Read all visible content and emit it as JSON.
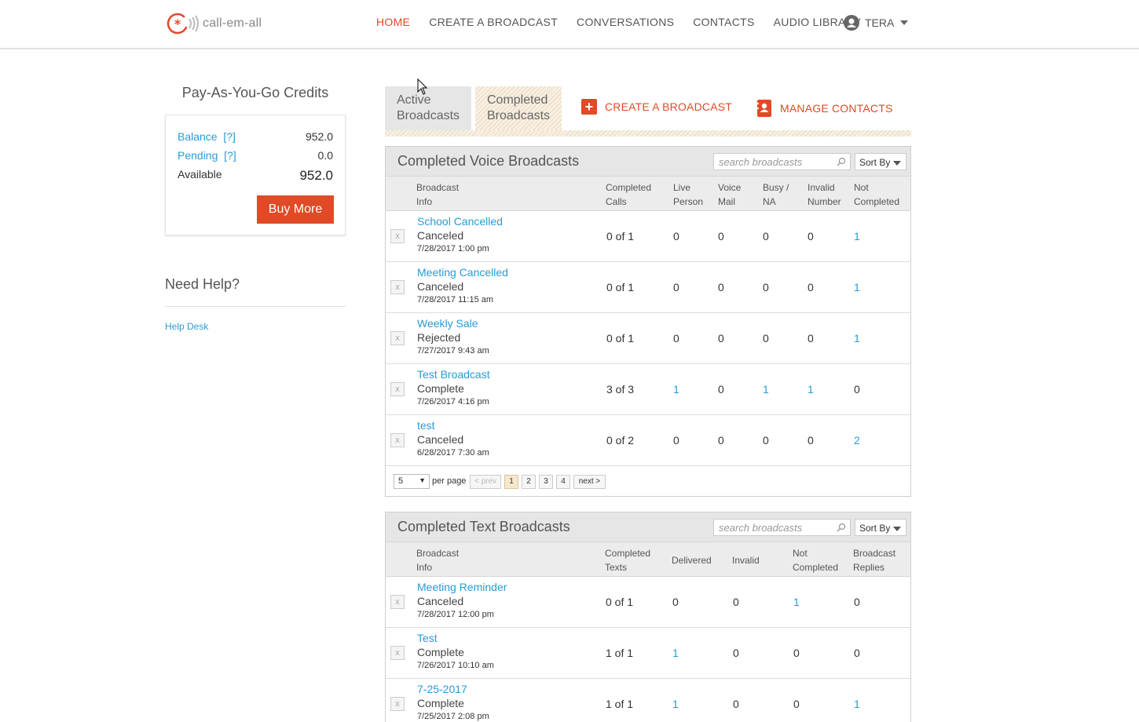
{
  "brand": {
    "name": "call-em-all"
  },
  "nav": {
    "items": [
      {
        "label": "HOME",
        "active": true
      },
      {
        "label": "CREATE A BROADCAST"
      },
      {
        "label": "CONVERSATIONS"
      },
      {
        "label": "CONTACTS"
      },
      {
        "label": "AUDIO LIBRARY"
      }
    ],
    "user": "TERA"
  },
  "credits": {
    "title": "Pay-As-You-Go Credits",
    "balance_label": "Balance  [?]",
    "balance": "952.0",
    "pending_label": "Pending  [?]",
    "pending": "0.0",
    "available_label": "Available",
    "available": "952.0",
    "buy_label": "Buy More"
  },
  "help": {
    "title": "Need Help?",
    "link": "Help Desk"
  },
  "tabs": {
    "active_broadcasts": "Active Broadcasts",
    "completed_broadcasts": "Completed Broadcasts",
    "create_label": "CREATE A BROADCAST",
    "manage_label": "MANAGE CONTACTS"
  },
  "voice": {
    "title": "Completed Voice Broadcasts",
    "search_placeholder": "search broadcasts",
    "sort_label": "Sort By",
    "headers": [
      "Broadcast Info",
      "Completed Calls",
      "Live Person",
      "Voice Mail",
      "Busy / NA",
      "Invalid Number",
      "Not Completed"
    ],
    "rows": [
      {
        "name": "School Cancelled",
        "status": "Canceled",
        "date": "7/28/2017 1:00 pm",
        "completed": "0 of 1",
        "live": "0",
        "vm": "0",
        "busy": "0",
        "invalid": "0",
        "notc": "1"
      },
      {
        "name": "Meeting Cancelled",
        "status": "Canceled",
        "date": "7/28/2017 11:15 am",
        "completed": "0 of 1",
        "live": "0",
        "vm": "0",
        "busy": "0",
        "invalid": "0",
        "notc": "1"
      },
      {
        "name": "Weekly Sale",
        "status": "Rejected",
        "date": "7/27/2017 9:43 am",
        "completed": "0 of 1",
        "live": "0",
        "vm": "0",
        "busy": "0",
        "invalid": "0",
        "notc": "1"
      },
      {
        "name": "Test Broadcast",
        "status": "Complete",
        "date": "7/26/2017 4:16 pm",
        "completed": "3 of 3",
        "live": "1",
        "vm": "0",
        "busy": "1",
        "invalid": "1",
        "notc": "0"
      },
      {
        "name": "test",
        "status": "Canceled",
        "date": "6/28/2017 7:30 am",
        "completed": "0 of 2",
        "live": "0",
        "vm": "0",
        "busy": "0",
        "invalid": "0",
        "notc": "2"
      }
    ],
    "pager": {
      "per_page": "5",
      "per_page_label": "per page",
      "prev": "< prev",
      "pages": [
        "1",
        "2",
        "3",
        "4"
      ],
      "next": "next >"
    }
  },
  "text": {
    "title": "Completed Text Broadcasts",
    "search_placeholder": "search broadcasts",
    "sort_label": "Sort By",
    "headers": [
      "Broadcast Info",
      "Completed Texts",
      "Delivered",
      "Invalid",
      "Not Completed",
      "Broadcast Replies"
    ],
    "rows": [
      {
        "name": "Meeting Reminder",
        "status": "Canceled",
        "date": "7/28/2017 12:00 pm",
        "completed": "0 of 1",
        "delivered": "0",
        "invalid": "0",
        "notc": "1",
        "replies": "0"
      },
      {
        "name": "Test",
        "status": "Complete",
        "date": "7/26/2017 10:10 am",
        "completed": "1 of 1",
        "delivered": "1",
        "invalid": "0",
        "notc": "0",
        "replies": "0"
      },
      {
        "name": "7-25-2017",
        "status": "Complete",
        "date": "7/25/2017 2:08 pm",
        "completed": "1 of 1",
        "delivered": "1",
        "invalid": "0",
        "notc": "0",
        "replies": "1"
      }
    ]
  },
  "colors": {
    "accent": "#e04a26",
    "link": "#2a9ad6"
  },
  "x_mark": "x"
}
